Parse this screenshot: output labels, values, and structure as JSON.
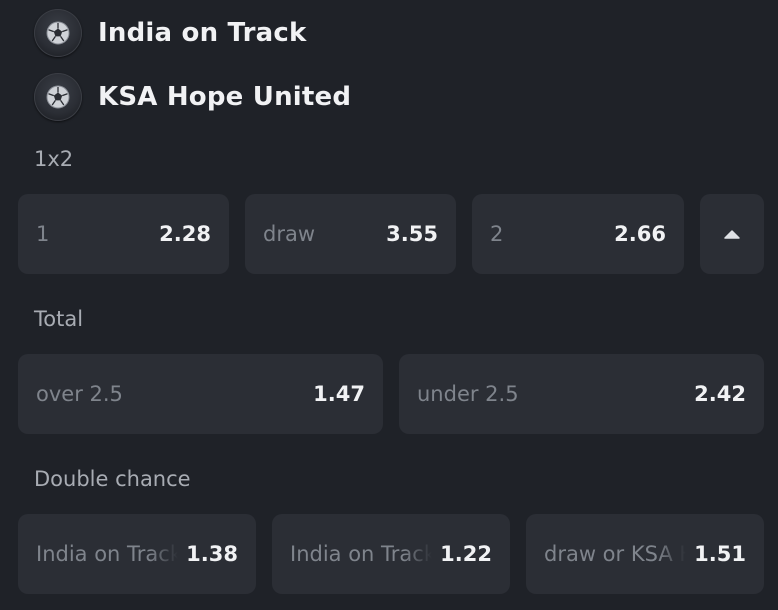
{
  "teams": [
    {
      "name": "India on Track",
      "icon": "soccer-ball-icon"
    },
    {
      "name": "KSA Hope United",
      "icon": "soccer-ball-icon"
    }
  ],
  "markets": {
    "one_x_two": {
      "title": "1x2",
      "outcomes": [
        {
          "label": "1",
          "odds": "2.28"
        },
        {
          "label": "draw",
          "odds": "3.55"
        },
        {
          "label": "2",
          "odds": "2.66"
        }
      ],
      "toggle_icon": "caret-up-icon"
    },
    "total": {
      "title": "Total",
      "outcomes": [
        {
          "label": "over 2.5",
          "odds": "1.47"
        },
        {
          "label": "under 2.5",
          "odds": "2.42"
        }
      ]
    },
    "double_chance": {
      "title": "Double chance",
      "outcomes": [
        {
          "label": "India on Track or draw",
          "odds": "1.38"
        },
        {
          "label": "India on Track or KSA Hope United",
          "odds": "1.22"
        },
        {
          "label": "draw or KSA Hope United",
          "odds": "1.51"
        }
      ]
    }
  },
  "colors": {
    "background": "#1f2228",
    "card": "#2b2e35",
    "label_muted": "#7f848c",
    "section_title": "#a8acb3",
    "text_primary": "#f1f2f4"
  }
}
